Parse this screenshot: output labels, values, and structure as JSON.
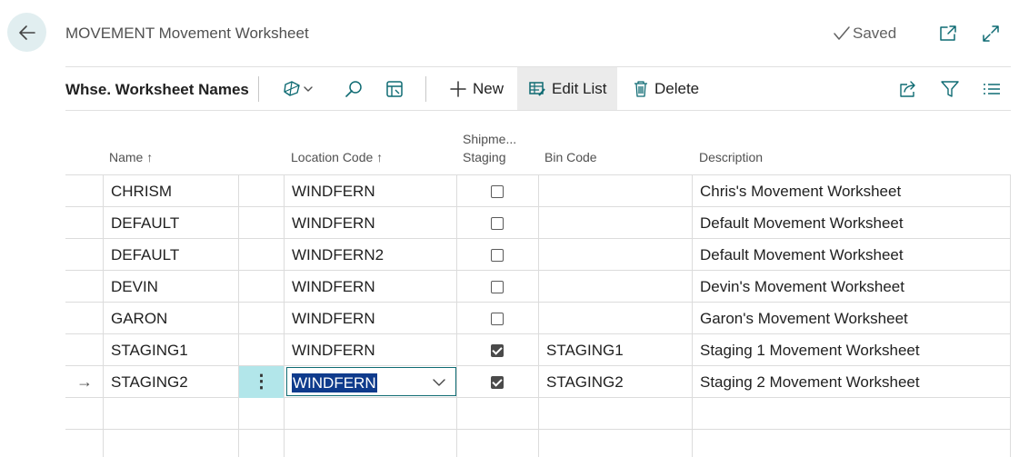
{
  "header": {
    "title": "MOVEMENT Movement Worksheet",
    "saved_label": "Saved"
  },
  "actionbar": {
    "title": "Whse. Worksheet Names",
    "new_label": "New",
    "edit_list_label": "Edit List",
    "delete_label": "Delete"
  },
  "columns": {
    "name": "Name ↑",
    "location_code": "Location Code ↑",
    "shipment_line1": "Shipme...",
    "shipment_line2": "Staging",
    "bin_code": "Bin Code",
    "description": "Description"
  },
  "rows": [
    {
      "name": "CHRISM",
      "location": "WINDFERN",
      "staging": false,
      "bin": "",
      "description": "Chris's Movement Worksheet"
    },
    {
      "name": "DEFAULT",
      "location": "WINDFERN",
      "staging": false,
      "bin": "",
      "description": "Default Movement Worksheet"
    },
    {
      "name": "DEFAULT",
      "location": "WINDFERN2",
      "staging": false,
      "bin": "",
      "description": "Default Movement Worksheet"
    },
    {
      "name": "DEVIN",
      "location": "WINDFERN",
      "staging": false,
      "bin": "",
      "description": "Devin's Movement Worksheet"
    },
    {
      "name": "GARON",
      "location": "WINDFERN",
      "staging": false,
      "bin": "",
      "description": "Garon's Movement Worksheet"
    },
    {
      "name": "STAGING1",
      "location": "WINDFERN",
      "staging": true,
      "bin": "STAGING1",
      "description": "Staging 1 Movement Worksheet"
    },
    {
      "name": "STAGING2",
      "location": "WINDFERN",
      "staging": true,
      "bin": "STAGING2",
      "description": "Staging 2 Movement Worksheet"
    }
  ],
  "current_row_marker": "→",
  "row_menu_glyph": "⋮",
  "colors": {
    "accent": "#0f6b73",
    "selected_cell": "#b2e6ea",
    "text_selection": "#0f3b8c",
    "back_button_bg": "#e1eef0"
  }
}
